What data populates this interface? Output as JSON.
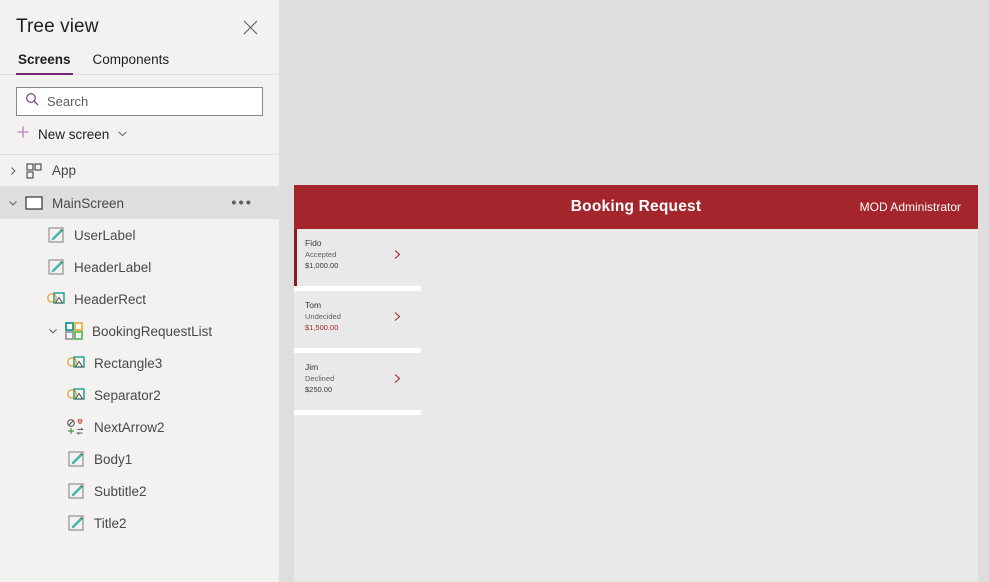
{
  "treeview": {
    "title": "Tree view",
    "close_icon": "close-icon",
    "tabs": [
      {
        "label": "Screens",
        "active": true
      },
      {
        "label": "Components",
        "active": false
      }
    ],
    "search": {
      "placeholder": "Search",
      "value": "",
      "icon": "search-icon"
    },
    "new_screen": {
      "label": "New screen",
      "plus_icon": "plus-icon",
      "chevron_icon": "chevron-down-icon"
    },
    "items": [
      {
        "name": "App",
        "icon": "app-icon",
        "indent": 0,
        "expander": "chevron-right-icon",
        "selected": false,
        "more": false
      },
      {
        "name": "MainScreen",
        "icon": "screen-icon",
        "indent": 1,
        "expander": "chevron-down-icon",
        "selected": true,
        "more": true,
        "more_label": "•••"
      },
      {
        "name": "UserLabel",
        "icon": "label-icon",
        "indent": 2,
        "expander": "",
        "selected": false,
        "more": false
      },
      {
        "name": "HeaderLabel",
        "icon": "label-icon",
        "indent": 2,
        "expander": "",
        "selected": false,
        "more": false
      },
      {
        "name": "HeaderRect",
        "icon": "shapes-icon",
        "indent": 2,
        "expander": "",
        "selected": false,
        "more": false
      },
      {
        "name": "BookingRequestList",
        "icon": "gallery-icon",
        "indent": 3,
        "expander": "chevron-down-icon",
        "selected": false,
        "more": false
      },
      {
        "name": "Rectangle3",
        "icon": "shapes-icon",
        "indent": 4,
        "expander": "",
        "selected": false,
        "more": false
      },
      {
        "name": "Separator2",
        "icon": "shapes-icon",
        "indent": 4,
        "expander": "",
        "selected": false,
        "more": false
      },
      {
        "name": "NextArrow2",
        "icon": "icons-icon",
        "indent": 4,
        "expander": "",
        "selected": false,
        "more": false
      },
      {
        "name": "Body1",
        "icon": "label-icon",
        "indent": 4,
        "expander": "",
        "selected": false,
        "more": false
      },
      {
        "name": "Subtitle2",
        "icon": "label-icon",
        "indent": 4,
        "expander": "",
        "selected": false,
        "more": false
      },
      {
        "name": "Title2",
        "icon": "label-icon",
        "indent": 4,
        "expander": "",
        "selected": false,
        "more": false
      }
    ]
  },
  "canvas": {
    "app": {
      "header": {
        "title": "Booking Request",
        "user": "MOD Administrator",
        "background": "#a4262c",
        "text_color": "#ffffff"
      },
      "gallery": {
        "items": [
          {
            "title": "Fido",
            "subtitle": "Accepted",
            "body": "$1,000.00",
            "selected": true,
            "body_accent": false,
            "arrow": "chevron-right-icon"
          },
          {
            "title": "Tom",
            "subtitle": "Undecided",
            "body": "$1,500.00",
            "selected": false,
            "body_accent": true,
            "arrow": "chevron-right-icon"
          },
          {
            "title": "Jim",
            "subtitle": "Declined",
            "body": "$250.00",
            "selected": false,
            "body_accent": false,
            "arrow": "chevron-right-icon"
          }
        ]
      }
    }
  },
  "colors": {
    "accent_red": "#a4262c",
    "accent_dark_red": "#8a1b22",
    "purple": "#742774",
    "panel_bg": "#f3f2f1",
    "canvas_bg": "#dedede",
    "screen_bg": "#e9e9e9"
  }
}
